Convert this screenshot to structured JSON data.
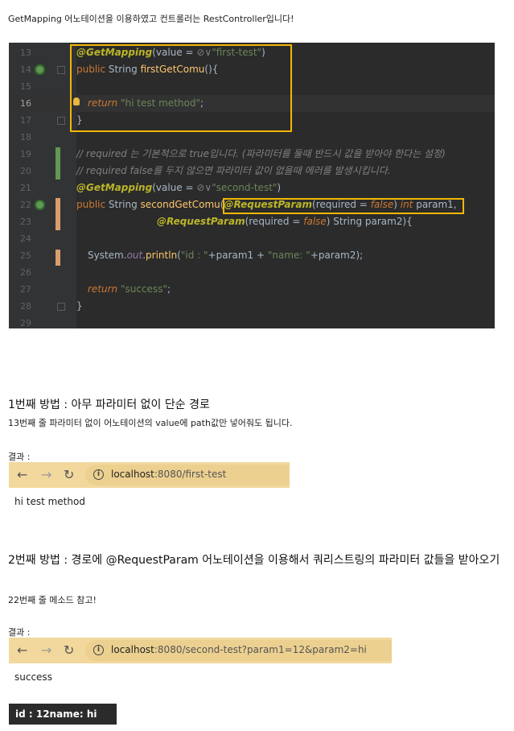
{
  "intro": "GetMapping 어노테이션을 이용하였고 컨트롤러는 RestController입니다!",
  "code": {
    "line_numbers": [
      "13",
      "14",
      "15",
      "16",
      "17",
      "18",
      "19",
      "20",
      "21",
      "22",
      "23",
      "24",
      "25",
      "26",
      "27",
      "28",
      "29"
    ],
    "l13": {
      "ann": "@GetMapping",
      "pl1": "(value = ",
      "icon": "⊘∨",
      "str": "\"first-test\"",
      "pl2": ")"
    },
    "l14": {
      "kw": "public",
      "pl1": " String ",
      "fn": "firstGetComu",
      "pl2": "(){"
    },
    "l16": {
      "kw": "return",
      "str": " \"hi test method\"",
      "pl": ";"
    },
    "l17": {
      "pl": "}"
    },
    "l19": {
      "cm": "// required 는 기본적으로 true입니다. (파라미터를 둘때 반드시 값을 받아야 한다는 설정)"
    },
    "l20": {
      "cm": "// required false를 두지 않으면 파라미터 값이 없을때 에러를 발생시킵니다."
    },
    "l21": {
      "ann": "@GetMapping",
      "pl1": "(value = ",
      "icon": "⊘∨",
      "str": "\"second-test\"",
      "pl2": ")"
    },
    "l22": {
      "kw": "public",
      "pl1": " String ",
      "fn": "secondGetComu",
      "pl2": "(",
      "ann": "@RequestParam",
      "pl3": "(required = ",
      "kw2": "false",
      "pl4": ") ",
      "kw3": "int",
      "pl5": " param1,"
    },
    "l23": {
      "ann": "@RequestParam",
      "pl1": "(required = ",
      "kw": "false",
      "pl2": ") String param2){"
    },
    "l25": {
      "pl1": "System.",
      "fld": "out",
      "pl2": ".",
      "fn": "println",
      "pl3": "(",
      "str1": "\"id : \"",
      "pl4": "+param1 + ",
      "str2": "\"name: \"",
      "pl5": "+param2);"
    },
    "l27": {
      "kw": "return",
      "str": " \"success\"",
      "pl": ";"
    },
    "l28": {
      "pl": "}"
    }
  },
  "section1": {
    "heading": "1번째 방법 : 아무 파라미터 없이 단순 경로",
    "desc": "13번째 줄 파라미터 없이 어노테이션의 value에 path값만 넣어줘도 됩니다.",
    "result_label": "결과 :",
    "url_host": "localhost",
    "url_path": ":8080/first-test",
    "output": "hi test method"
  },
  "section2": {
    "heading": "2번째 방법 : 경로에 @RequestParam 어노테이션을 이용해서 쿼리스트링의 파라미터 값들을 받아오기",
    "desc": "22번째 줄 메소드 참고!",
    "result_label": "결과 :",
    "url_host": "localhost",
    "url_path": ":8080/second-test?param1=12&param2=hi",
    "output": "success",
    "console": "id : 12name: hi"
  },
  "browser_icons": {
    "back": "back-arrow-icon",
    "forward": "forward-arrow-icon",
    "reload": "reload-icon",
    "info": "info-icon"
  },
  "colors": {
    "highlight_box": "#f2b705",
    "browser_bar": "#f2d89d",
    "code_bg": "#2b2b2b"
  }
}
